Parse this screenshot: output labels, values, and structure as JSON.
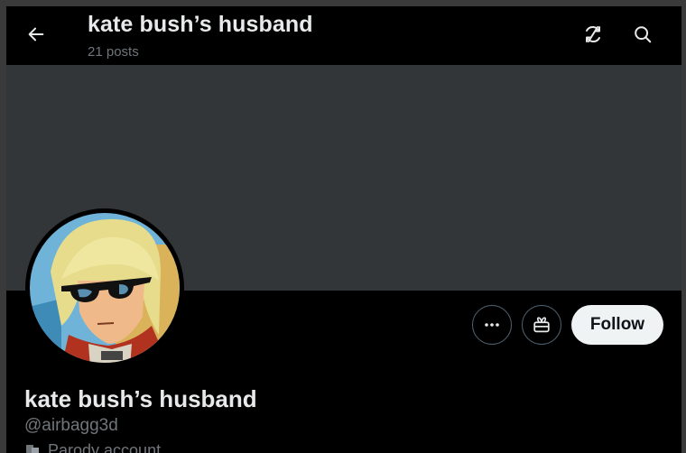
{
  "header": {
    "title": "kate bush’s husband",
    "posts_count": "21 posts",
    "back_icon": "arrow-left-icon",
    "sync_icon": "refresh-off-icon",
    "search_icon": "search-icon"
  },
  "profile": {
    "display_name": "kate bush’s husband",
    "handle": "@airbagg3d",
    "label": "Parody account",
    "label_icon": "theater-mask-icon"
  },
  "actions": {
    "more_icon": "more-dots-icon",
    "subscribe_icon": "gift-icon",
    "follow_label": "Follow"
  },
  "colors": {
    "background": "#000000",
    "banner": "#333639",
    "text_primary": "#e7e9ea",
    "text_secondary": "#71767b",
    "follow_bg": "#eff3f4"
  }
}
